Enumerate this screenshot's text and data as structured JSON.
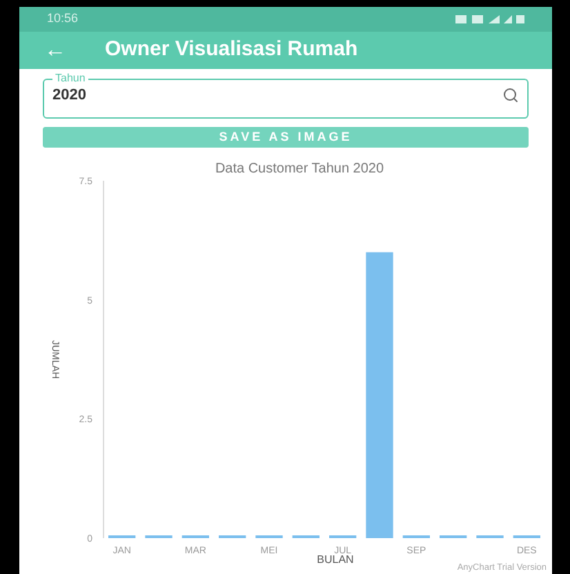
{
  "status_bar": {
    "time": "10:56"
  },
  "app_bar": {
    "back": "←",
    "title": "Owner Visualisasi Rumah"
  },
  "year_field": {
    "label": "Tahun",
    "value": "2020"
  },
  "save_button": {
    "label": "SAVE AS IMAGE"
  },
  "chart": {
    "chart_data": {
      "type": "bar",
      "title": "Data Customer Tahun 2020",
      "xlabel": "BULAN",
      "ylabel": "JUMLAH",
      "categories": [
        "JAN",
        null,
        "MAR",
        null,
        "MEI",
        null,
        "JUL",
        null,
        "SEP",
        null,
        null,
        "DES"
      ],
      "series": [
        {
          "color": "#7bbfee",
          "values": [
            0,
            0,
            0,
            0,
            0,
            0,
            0,
            6,
            0,
            0,
            0,
            0
          ]
        }
      ],
      "ylim": [
        0,
        7.5
      ],
      "yticks": [
        0,
        2.5,
        5,
        7.5
      ]
    },
    "credit": "AnyChart Trial Version"
  }
}
